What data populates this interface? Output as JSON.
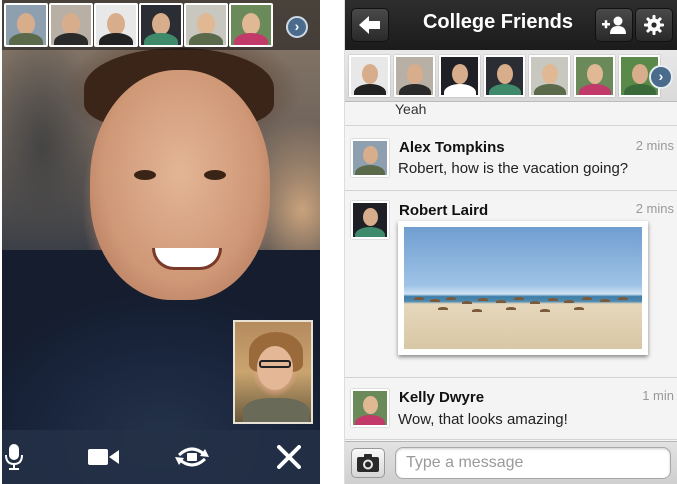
{
  "left_call": {
    "participants": [
      {
        "name": "participant-1",
        "shirt": "#5a6a4a"
      },
      {
        "name": "participant-2",
        "shirt": "#2a2a2a"
      },
      {
        "name": "participant-3",
        "shirt": "#ffffff"
      },
      {
        "name": "participant-4",
        "shirt": "#3e8a6a"
      },
      {
        "name": "participant-5",
        "shirt": "#5a6a4a"
      },
      {
        "name": "participant-6",
        "shirt": "#c23a6a"
      }
    ],
    "controls": [
      "microphone-icon",
      "video-camera-icon",
      "switch-camera-icon",
      "close-icon"
    ]
  },
  "chat": {
    "title": "College Friends",
    "back_icon": "back-arrow-icon",
    "add_person_icon": "add-person-icon",
    "settings_icon": "gear-icon",
    "partial_previous_text": "Yeah",
    "messages": [
      {
        "sender": "Alex Tompkins",
        "time": "2 mins",
        "text": "Robert, how is the vacation going?"
      },
      {
        "sender": "Robert Laird",
        "time": "2 mins",
        "text": ""
      },
      {
        "sender": "Kelly Dwyre",
        "time": "1 min",
        "text": "Wow, that looks amazing!"
      }
    ],
    "composer": {
      "placeholder": "Type a message",
      "camera_icon": "camera-icon"
    }
  },
  "colors": {
    "nav_bar": "#1b1b1b",
    "arrow_badge": "#4b6b8c",
    "timestamp": "#999999"
  }
}
